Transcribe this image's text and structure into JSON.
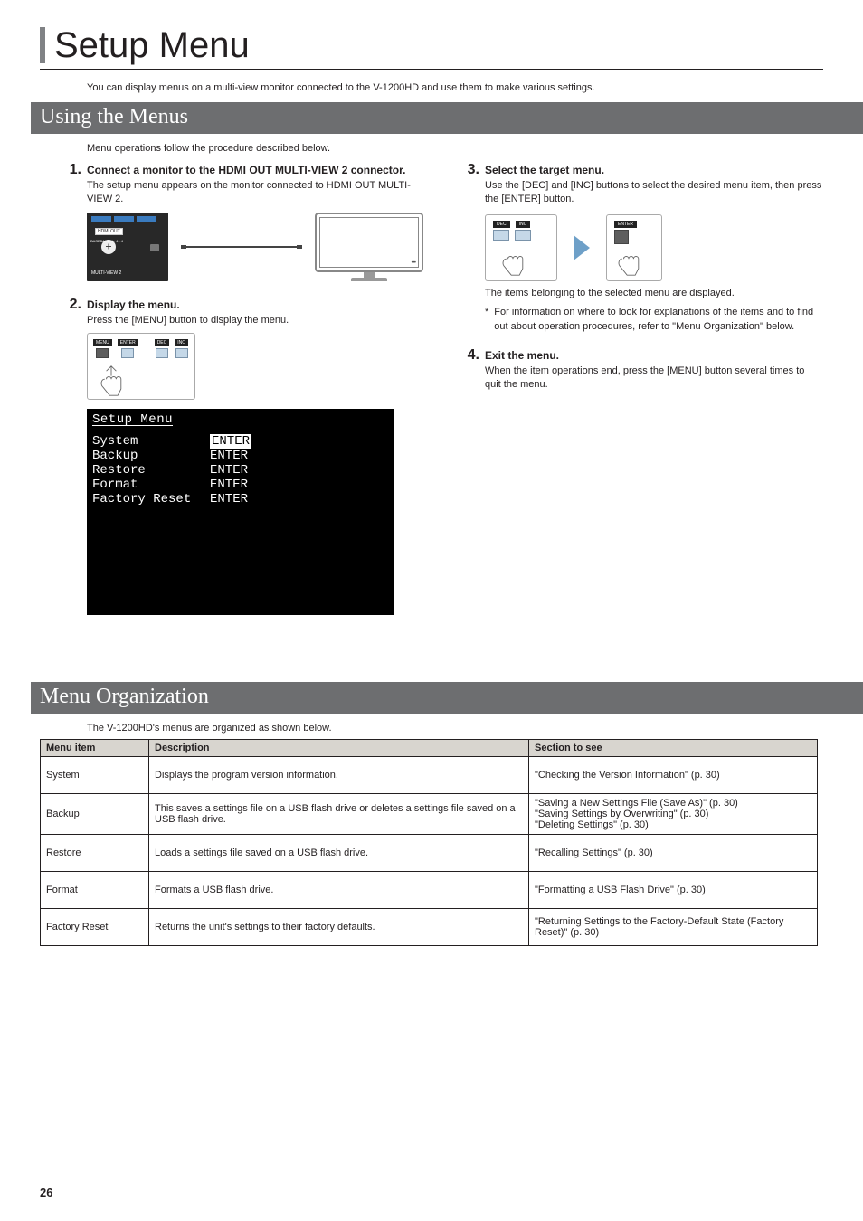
{
  "pageTitle": "Setup Menu",
  "intro": "You can display menus on a multi-view monitor connected to the V-1200HD and use them to make various settings.",
  "section1": {
    "heading": "Using the Menus",
    "intro": "Menu operations follow the procedure described below.",
    "step1": {
      "num": "1",
      "title": "Connect a monitor to the HDMI OUT MULTI-VIEW 2 connector.",
      "body": "The setup menu appears on the monitor connected to HDMI OUT MULTI-VIEW 2.",
      "panel": {
        "hdmiOut": "HDMI OUT",
        "baseband": "BASEBAND",
        "four44": "4 : 4 : 4",
        "mv2": "MULTI-VIEW 2"
      }
    },
    "step2": {
      "num": "2",
      "title": "Display the menu.",
      "body": "Press the [MENU] button to display the menu.",
      "btns": {
        "menu": "MENU",
        "enter": "ENTER",
        "dec": "DEC",
        "inc": "INC"
      },
      "menuScreenshot": {
        "title": "Setup Menu",
        "rows": [
          {
            "k": "System",
            "v": "ENTER",
            "hl": true
          },
          {
            "k": "Backup",
            "v": "ENTER"
          },
          {
            "k": "Restore",
            "v": "ENTER"
          },
          {
            "k": "Format",
            "v": "ENTER"
          },
          {
            "k": "Factory Reset",
            "v": "ENTER"
          }
        ]
      }
    },
    "step3": {
      "num": "3",
      "title": "Select the target menu.",
      "body": "Use the [DEC] and [INC] buttons to select the desired menu item, then press the [ENTER] button.",
      "btns": {
        "dec": "DEC",
        "inc": "INC",
        "enter": "ENTER"
      },
      "after": "The items belonging to the selected menu are displayed.",
      "note": "For information on where to look for explanations of the items and to find out about operation procedures, refer to \"Menu Organization\" below."
    },
    "step4": {
      "num": "4",
      "title": "Exit the menu.",
      "body": "When the item operations end, press the [MENU] button several times to quit the menu."
    }
  },
  "section2": {
    "heading": "Menu Organization",
    "intro": "The V-1200HD's menus are organized as shown below.",
    "headers": {
      "item": "Menu item",
      "desc": "Description",
      "sec": "Section to see"
    },
    "rows": [
      {
        "item": "System",
        "desc": "Displays the program version information.",
        "sec": "\"Checking the Version Information\" (p. 30)"
      },
      {
        "item": "Backup",
        "desc": "This saves a settings file on a USB flash drive or deletes a settings file saved on a USB flash drive.",
        "sec": "\"Saving a New Settings File (Save As)\" (p. 30)\n\"Saving Settings by Overwriting\" (p. 30)\n\"Deleting Settings\" (p. 30)"
      },
      {
        "item": "Restore",
        "desc": "Loads a settings file saved on a USB flash drive.",
        "sec": "\"Recalling Settings\" (p. 30)"
      },
      {
        "item": "Format",
        "desc": "Formats a USB flash drive.",
        "sec": "\"Formatting a USB Flash Drive\" (p. 30)"
      },
      {
        "item": "Factory Reset",
        "desc": "Returns the unit's settings to their factory defaults.",
        "sec": "\"Returning Settings to the Factory-Default State (Factory Reset)\" (p. 30)"
      }
    ]
  },
  "pageNumber": "26"
}
